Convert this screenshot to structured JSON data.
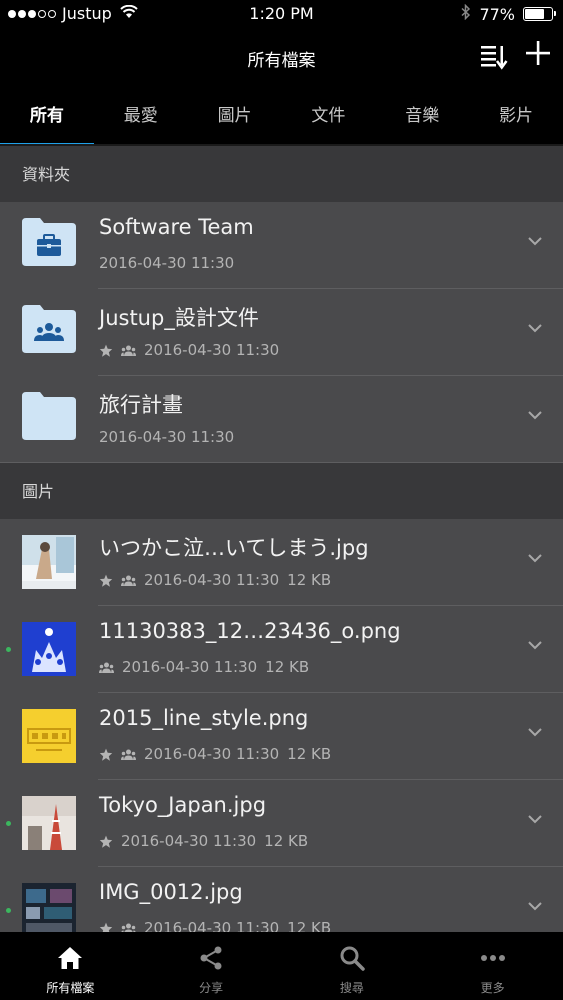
{
  "status_bar": {
    "carrier": "Justup",
    "time": "1:20 PM",
    "battery_text": "77%",
    "battery_level": 0.77,
    "signal_bars": 3,
    "signal_total": 5
  },
  "nav": {
    "title": "所有檔案"
  },
  "tabs": [
    {
      "label": "所有",
      "active": true
    },
    {
      "label": "最愛",
      "active": false
    },
    {
      "label": "圖片",
      "active": false
    },
    {
      "label": "文件",
      "active": false
    },
    {
      "label": "音樂",
      "active": false
    },
    {
      "label": "影片",
      "active": false
    }
  ],
  "sections": {
    "folders_label": "資料夾",
    "images_label": "圖片"
  },
  "folders": [
    {
      "name": "Software Team",
      "date": "2016-04-30 11:30",
      "icon": "briefcase-icon",
      "starred": false,
      "shared": false
    },
    {
      "name": "Justup_設計文件",
      "date": "2016-04-30 11:30",
      "icon": "people-icon",
      "starred": true,
      "shared": true
    },
    {
      "name": "旅行計畫",
      "date": "2016-04-30 11:30",
      "icon": "folder-icon",
      "starred": false,
      "shared": false
    }
  ],
  "images": [
    {
      "name": "いつかこ泣…いてしまう.jpg",
      "date": "2016-04-30 11:30",
      "size": "12 KB",
      "starred": true,
      "shared": true,
      "new": false
    },
    {
      "name": "11130383_12…23436_o.png",
      "date": "2016-04-30 11:30",
      "size": "12 KB",
      "starred": false,
      "shared": true,
      "new": true
    },
    {
      "name": "2015_line_style.png",
      "date": "2016-04-30 11:30",
      "size": "12 KB",
      "starred": true,
      "shared": true,
      "new": false
    },
    {
      "name": "Tokyo_Japan.jpg",
      "date": "2016-04-30 11:30",
      "size": "12 KB",
      "starred": true,
      "shared": false,
      "new": true
    },
    {
      "name": "IMG_0012.jpg",
      "date": "2016-04-30 11:30",
      "size": "12 KB",
      "starred": true,
      "shared": true,
      "new": true
    }
  ],
  "bottom_tabs": [
    {
      "label": "所有檔案",
      "icon": "home-icon",
      "active": true
    },
    {
      "label": "分享",
      "icon": "share-icon",
      "active": false
    },
    {
      "label": "搜尋",
      "icon": "search-icon",
      "active": false
    },
    {
      "label": "更多",
      "icon": "more-icon",
      "active": false
    }
  ],
  "colors": {
    "accent": "#1fa0e8",
    "folder": "#cfe4f5",
    "folder_glyph": "#1d5a9a",
    "new_dot": "#3bb75e"
  }
}
